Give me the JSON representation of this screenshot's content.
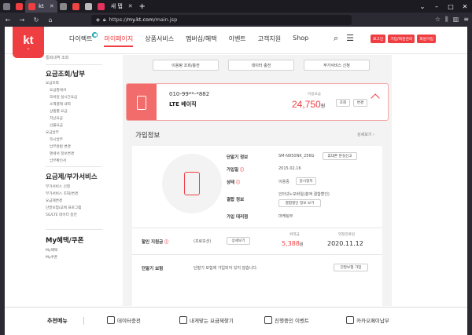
{
  "browser": {
    "active_tab_label": "kt",
    "new_tab_label": "새 탭",
    "url_prefix": "https://",
    "url_host": "my.kt.com",
    "url_path": "/main.jsp"
  },
  "header": {
    "logo_text": "kt",
    "nav": [
      "다이렉트",
      "마이페이지",
      "상품서비스",
      "멤버십/혜택",
      "이벤트",
      "고객지원",
      "Shop"
    ],
    "active_nav": "마이페이지",
    "direct_badge": "■",
    "buttons": [
      {
        "label": "로그인",
        "color": "#ef3e42"
      },
      {
        "label": "가입/회원관리",
        "color": "#ef3e42"
      },
      {
        "label": "회원가입",
        "color": "#ef3e42"
      }
    ]
  },
  "sidebar": {
    "top_item": "통화내역 조회",
    "group1": {
      "title": "요금조회/납부",
      "links": [
        "요금조회",
        "요금명세서",
        "모바일 실시간요금",
        "소액결제 내역",
        "상품별 요금",
        "지난요금",
        "선불요금"
      ],
      "sub_title": "요금납부",
      "sub_links": [
        "즉시납부",
        "납부방법 변경",
        "명세서 정보변경",
        "납부확인서"
      ]
    },
    "group2": {
      "title": "요금제/부가서비스",
      "links": [
        "부가서비스 신청",
        "부가서비스 조회/변경",
        "요금제변경",
        "단말보험/교체 프로그램",
        "5G/LTE 데이터 충전"
      ]
    },
    "group3": {
      "title": "My혜택/쿠폰",
      "links": [
        "My혜택",
        "My쿠폰"
      ]
    }
  },
  "main": {
    "top_buttons": [
      "이용량 조회/충전",
      "데이터 충전",
      "부가서비스 신청"
    ],
    "plan_card": {
      "phone_number": "010-99**-*882",
      "plan_name": "LTE 베이직",
      "fee_label": "이용요금",
      "fee_value": "24,750",
      "fee_unit": "원",
      "btn_detail": "조회",
      "btn_change": "변경"
    },
    "info": {
      "title": "가입정보",
      "detail_link": "상세보기 ›",
      "device_label": "단말기 정보",
      "device_value": "SM-N950NK_256G",
      "device_btn": "휴대폰 분실신고",
      "join_date_label": "가입일",
      "join_date_value": "2015.02.16",
      "status_label": "상태",
      "status_value": "이용중",
      "status_btn": "일시정지",
      "discount_label": "결합 정보",
      "discount_value": "인터넷+모바일(총액 결합할인)",
      "discount_btn": "결합할인 정보 보기",
      "agent_label": "가입 대리점",
      "agent_value": "마케팅부",
      "subsidy_label": "할인 지원금",
      "subsidy_type": "(프로모션)",
      "subsidy_btn": "상세보기",
      "penalty_label": "위약금",
      "penalty_value": "5,388",
      "penalty_unit": "원",
      "contract_end_label": "약정만료일",
      "contract_end_value": "2020.11.12",
      "insurance_label": "단말기 보험",
      "insurance_text": "단말기 보험에 가입되어 있지 않습니다.",
      "insurance_btn": "단말보험 가입"
    }
  },
  "bottom": {
    "title": "추천메뉴",
    "items": [
      "데이터충전",
      "내게맞는 요금제찾기",
      "진행중인 이벤트",
      "카카오페이납부"
    ]
  }
}
